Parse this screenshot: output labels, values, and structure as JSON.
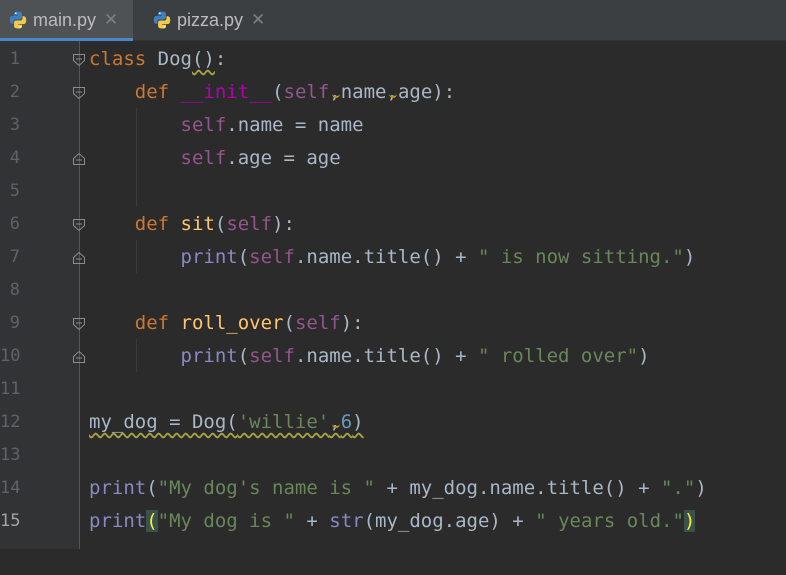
{
  "tabs": [
    {
      "label": "main.py",
      "active": true,
      "icon": "python-icon",
      "close": "✕"
    },
    {
      "label": "pizza.py",
      "active": false,
      "icon": "python-icon",
      "close": "✕"
    }
  ],
  "editor": {
    "current_line": 15,
    "line_numbers": [
      "1",
      "2",
      "3",
      "4",
      "5",
      "6",
      "7",
      "8",
      "9",
      "10",
      "11",
      "12",
      "13",
      "14",
      "15"
    ],
    "lines": [
      [
        {
          "t": "class",
          "c": "kw"
        },
        {
          "t": " Dog"
        },
        {
          "t": "()",
          "c": "wavy"
        },
        {
          "t": ":"
        }
      ],
      [
        {
          "t": "    "
        },
        {
          "t": "def",
          "c": "kw"
        },
        {
          "t": " "
        },
        {
          "t": "__init__",
          "c": "magic fn"
        },
        {
          "t": "("
        },
        {
          "t": "self",
          "c": "self"
        },
        {
          "t": ",",
          "c": "comma"
        },
        {
          "t": "name"
        },
        {
          "t": ",",
          "c": "comma"
        },
        {
          "t": "age):"
        }
      ],
      [
        {
          "t": "        "
        },
        {
          "t": "self",
          "c": "self"
        },
        {
          "t": ".name = name"
        }
      ],
      [
        {
          "t": "        "
        },
        {
          "t": "self",
          "c": "self"
        },
        {
          "t": ".age = age"
        }
      ],
      [],
      [
        {
          "t": "    "
        },
        {
          "t": "def",
          "c": "kw"
        },
        {
          "t": " "
        },
        {
          "t": "sit",
          "c": "fn"
        },
        {
          "t": "("
        },
        {
          "t": "self",
          "c": "self"
        },
        {
          "t": "):"
        }
      ],
      [
        {
          "t": "        "
        },
        {
          "t": "print",
          "c": "builtin"
        },
        {
          "t": "("
        },
        {
          "t": "self",
          "c": "self"
        },
        {
          "t": ".name.title() + "
        },
        {
          "t": "\" is now sitting.\"",
          "c": "str"
        },
        {
          "t": ")"
        }
      ],
      [],
      [
        {
          "t": "    "
        },
        {
          "t": "def",
          "c": "kw"
        },
        {
          "t": " "
        },
        {
          "t": "roll_over",
          "c": "fn"
        },
        {
          "t": "("
        },
        {
          "t": "self",
          "c": "self"
        },
        {
          "t": "):"
        }
      ],
      [
        {
          "t": "        "
        },
        {
          "t": "print",
          "c": "builtin"
        },
        {
          "t": "("
        },
        {
          "t": "self",
          "c": "self"
        },
        {
          "t": ".name.title() + "
        },
        {
          "t": "\" rolled over\"",
          "c": "str"
        },
        {
          "t": ")"
        }
      ],
      [],
      [
        {
          "t": "my_dog = Dog(",
          "c": "wavy"
        },
        {
          "t": "'willie'",
          "c": "str wavy"
        },
        {
          "t": ",",
          "c": "wavy comma"
        },
        {
          "t": "6",
          "c": "num wavy"
        },
        {
          "t": ")",
          "c": "wavy"
        }
      ],
      [],
      [
        {
          "t": "print",
          "c": "builtin"
        },
        {
          "t": "("
        },
        {
          "t": "\"My dog's name is \"",
          "c": "str"
        },
        {
          "t": " + my_dog.name.title() + "
        },
        {
          "t": "\".\"",
          "c": "str"
        },
        {
          "t": ")"
        }
      ],
      [
        {
          "t": "print",
          "c": "builtin"
        },
        {
          "t": "(",
          "c": "pair"
        },
        {
          "t": "\"My dog is \"",
          "c": "str"
        },
        {
          "t": " + "
        },
        {
          "t": "str",
          "c": "builtin"
        },
        {
          "t": "(my_dog.age) + "
        },
        {
          "t": "\" years old.\"",
          "c": "str"
        },
        {
          "t": ")",
          "c": "pair"
        }
      ]
    ],
    "fold_markers": [
      {
        "line": 1,
        "kind": "open"
      },
      {
        "line": 2,
        "kind": "open"
      },
      {
        "line": 4,
        "kind": "close"
      },
      {
        "line": 6,
        "kind": "open"
      },
      {
        "line": 7,
        "kind": "close"
      },
      {
        "line": 9,
        "kind": "open"
      },
      {
        "line": 10,
        "kind": "close"
      }
    ]
  },
  "colors": {
    "background": "#2b2b2b",
    "gutter": "#313335",
    "keyword": "#cc7832",
    "function": "#ffc66d",
    "self": "#94558d",
    "string": "#6a8759",
    "number": "#6897bb",
    "builtin": "#8888c6",
    "accent": "#4a88c7"
  }
}
